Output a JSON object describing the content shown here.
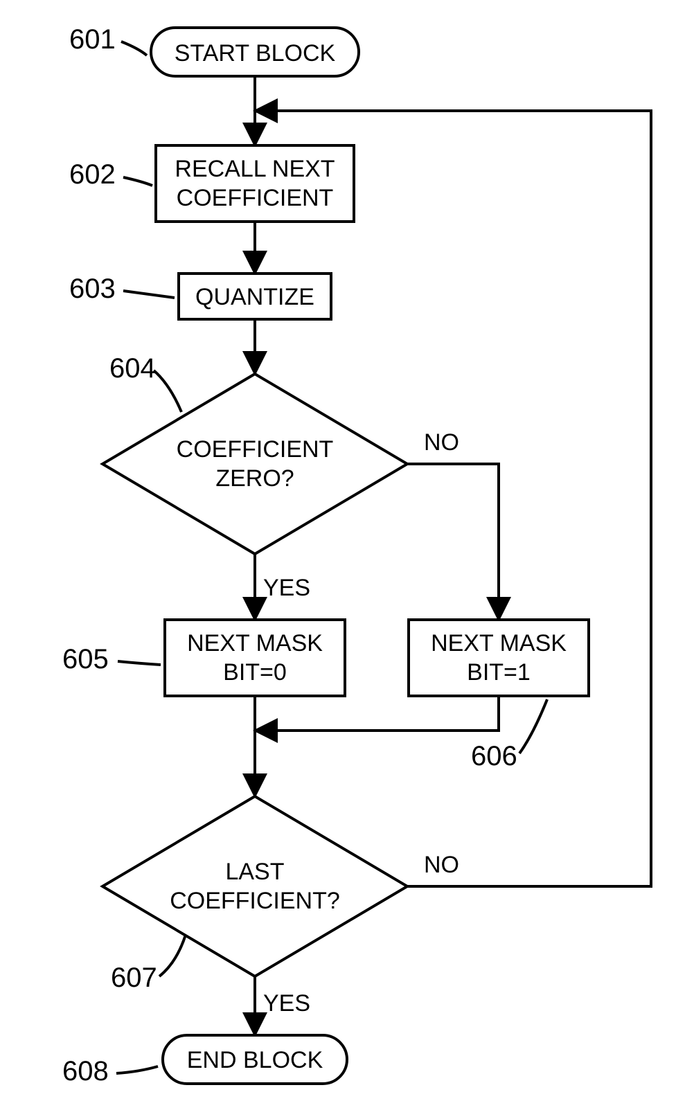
{
  "labels": {
    "l601": "601",
    "l602": "602",
    "l603": "603",
    "l604": "604",
    "l605": "605",
    "l606": "606",
    "l607": "607",
    "l608": "608"
  },
  "nodes": {
    "start": "START BLOCK",
    "recall_l1": "RECALL NEXT",
    "recall_l2": "COEFFICIENT",
    "quantize": "QUANTIZE",
    "coef_zero_l1": "COEFFICIENT",
    "coef_zero_l2": "ZERO?",
    "mask0_l1": "NEXT MASK",
    "mask0_l2": "BIT=0",
    "mask1_l1": "NEXT MASK",
    "mask1_l2": "BIT=1",
    "last_l1": "LAST",
    "last_l2": "COEFFICIENT?",
    "end": "END BLOCK"
  },
  "edges": {
    "yes": "YES",
    "no": "NO"
  }
}
